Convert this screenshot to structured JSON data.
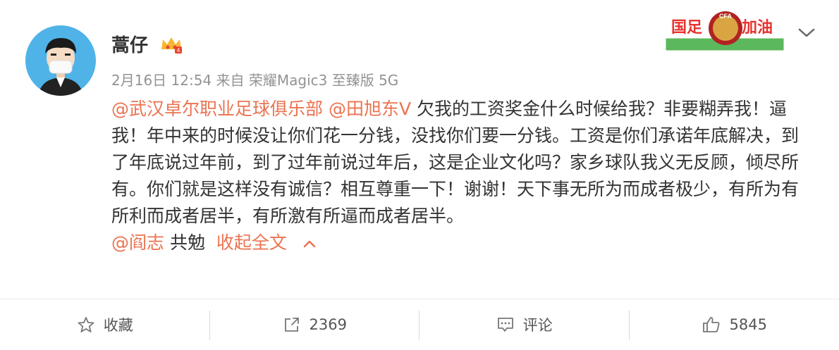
{
  "post": {
    "author": "蒿仔",
    "meta": "2月16日 12:54 来自 荣耀Magic3 至臻版 5G",
    "mention1": "@武汉卓尔职业足球俱乐部",
    "mention2": "@田旭东V",
    "body": " 欠我的工资奖金什么时候给我？非要糊弄我！逼我！年中来的时候没让你们花一分钱，没找你们要一分钱。工资是你们承诺年底解决，到了年底说过年前，到了过年前说过年后，这是企业文化吗？家乡球队我义无反顾，倾尽所有。你们就是这样没有诚信？相互尊重一下！谢谢！天下事无所为而成者极少，有所为有所利而成者居半，有所激有所逼而成者居半。",
    "mention3": "@阎志",
    "tail": " 共勉",
    "collapse": "收起全文"
  },
  "banner": {
    "text_left": "国足",
    "text_right": "加油",
    "logo_text": "CFA"
  },
  "actions": {
    "favorite": "收藏",
    "repost": "2369",
    "comment": "评论",
    "like": "5845"
  },
  "colors": {
    "link": "#eb7350",
    "text": "#333333",
    "meta": "#939393",
    "avatar_bg": "#4fb3e8"
  }
}
